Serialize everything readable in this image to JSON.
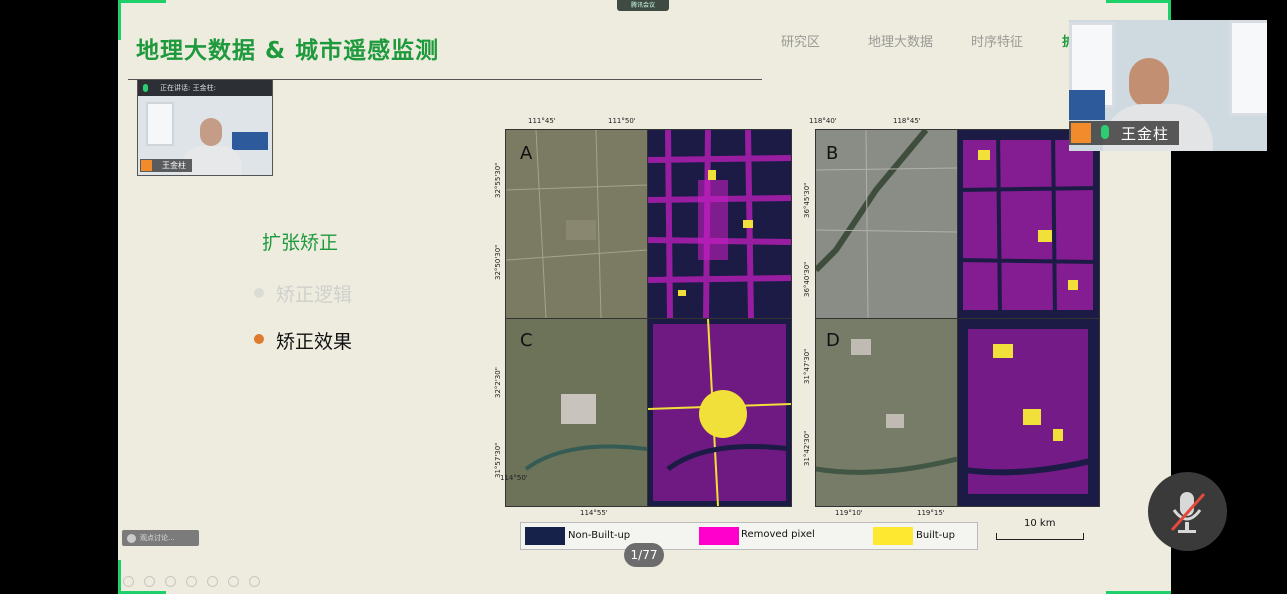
{
  "meeting_badge": "腾讯会议",
  "slide": {
    "title": "地理大数据 & 城市遥感监测",
    "nav": [
      "研究区",
      "地理大数据",
      "时序特征",
      "扩"
    ],
    "section": "扩张矫正",
    "bullets": [
      {
        "text": "矫正逻辑",
        "color": "#d0d0cc",
        "dot": "#dcdcd6"
      },
      {
        "text": "矫正效果",
        "color": "#111111",
        "dot": "#e07a2e"
      }
    ],
    "panels": {
      "letters": [
        "A",
        "B",
        "C",
        "D"
      ],
      "top_left_ticks": [
        "111°45'",
        "111°50'"
      ],
      "top_right_ticks": [
        "118°40'",
        "118°45'"
      ],
      "left_a_ticks": [
        "32°55'30\"",
        "32°50'30\""
      ],
      "left_b_ticks": [
        "36°45'30\"",
        "36°40'30\""
      ],
      "left_c_ticks": [
        "32°2'30\"",
        "31°57'30\""
      ],
      "left_d_ticks": [
        "31°47'30\"",
        "31°42'30\""
      ],
      "bottom_left_ticks": [
        "114°50'",
        "114°55'"
      ],
      "bottom_right_ticks": [
        "119°10'",
        "119°15'"
      ]
    },
    "legend": [
      {
        "label": "Non-Built-up",
        "color": "#17224a"
      },
      {
        "label": "Removed pixel",
        "color": "#ff00cc"
      },
      {
        "label": "Built-up",
        "color": "#ffe830"
      }
    ],
    "scale_label": "10 km",
    "page_indicator": "1/77"
  },
  "video_small": {
    "speaking": "正在讲话: 王金柱:",
    "name": "王金柱"
  },
  "video_large": {
    "name": "王金柱"
  },
  "control_label": "观点讨论..."
}
